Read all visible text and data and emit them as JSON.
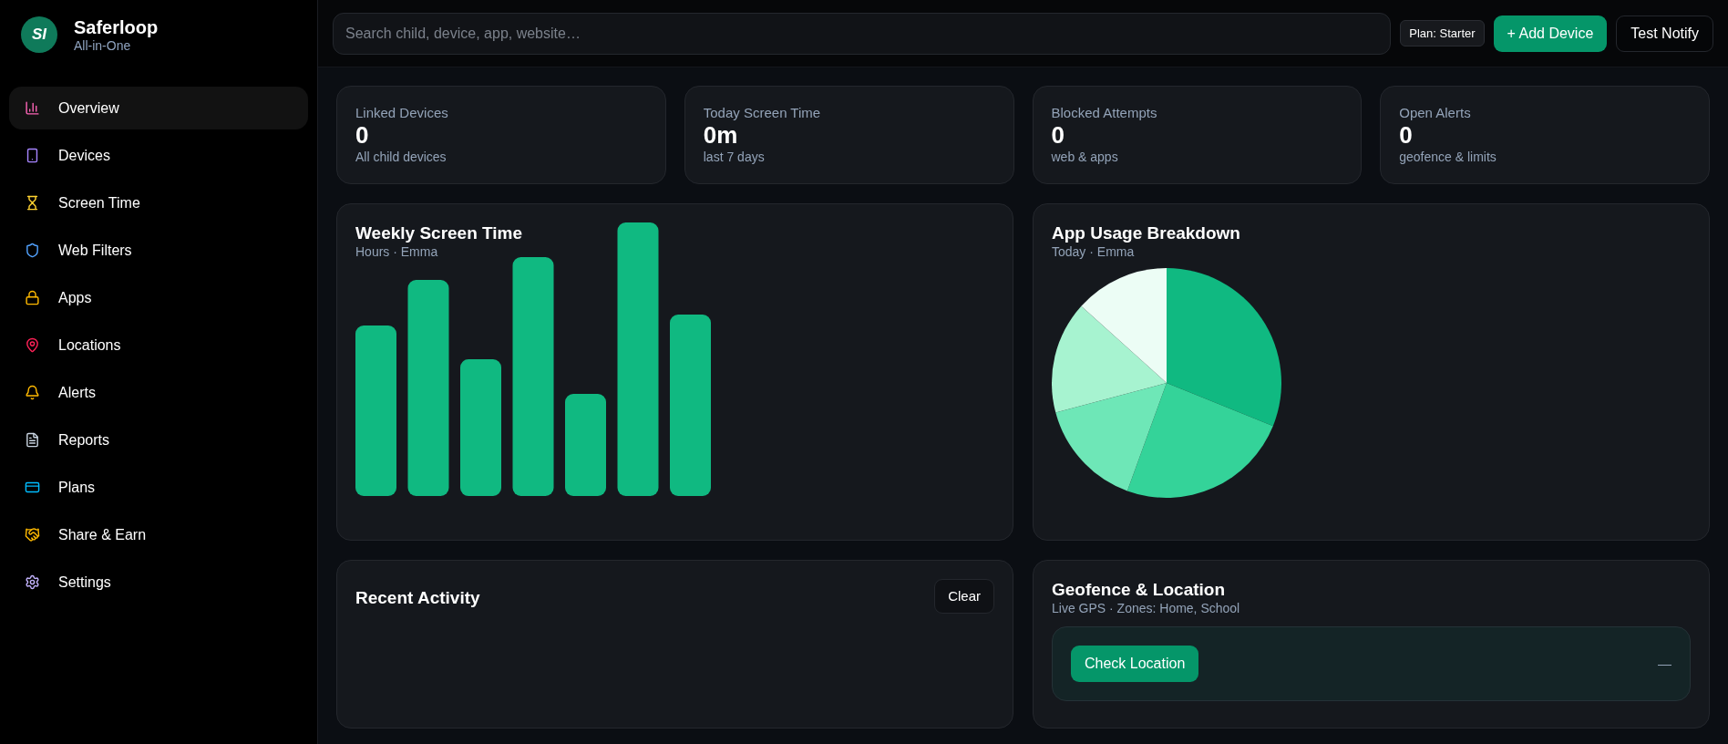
{
  "brand": {
    "name": "Saferloop",
    "tagline": "All-in-One",
    "logo_text": "SI"
  },
  "nav": [
    {
      "label": "Overview",
      "selected": true
    },
    {
      "label": "Devices",
      "selected": false
    },
    {
      "label": "Screen Time",
      "selected": false
    },
    {
      "label": "Web Filters",
      "selected": false
    },
    {
      "label": "Apps",
      "selected": false
    },
    {
      "label": "Locations",
      "selected": false
    },
    {
      "label": "Alerts",
      "selected": false
    },
    {
      "label": "Reports",
      "selected": false
    },
    {
      "label": "Plans",
      "selected": false
    },
    {
      "label": "Share & Earn",
      "selected": false
    },
    {
      "label": "Settings",
      "selected": false
    }
  ],
  "header": {
    "search": {
      "placeholder": "Search child, device, app, website…"
    },
    "plan_badge": "Plan: Starter",
    "add_button": "+ Add Device",
    "notify_button": "Test Notify"
  },
  "stats": [
    {
      "label": "Linked Devices",
      "value": "0",
      "note": "All child devices"
    },
    {
      "label": "Today Screen Time",
      "value": "0m",
      "note": "last 7 days"
    },
    {
      "label": "Blocked Attempts",
      "value": "0",
      "note": "web & apps"
    },
    {
      "label": "Open Alerts",
      "value": "0",
      "note": "geofence & limits"
    }
  ],
  "weekly": {
    "title": "Weekly Screen Time",
    "subtitle": "Hours · Emma"
  },
  "usage": {
    "title": "App Usage Breakdown",
    "subtitle": "Today · Emma"
  },
  "activity": {
    "title": "Recent Activity",
    "clear_button": "Clear"
  },
  "geofence": {
    "title": "Geofence & Location",
    "subtitle": "Live GPS · Zones: Home, School",
    "check_button": "Check Location",
    "status": "—"
  }
}
